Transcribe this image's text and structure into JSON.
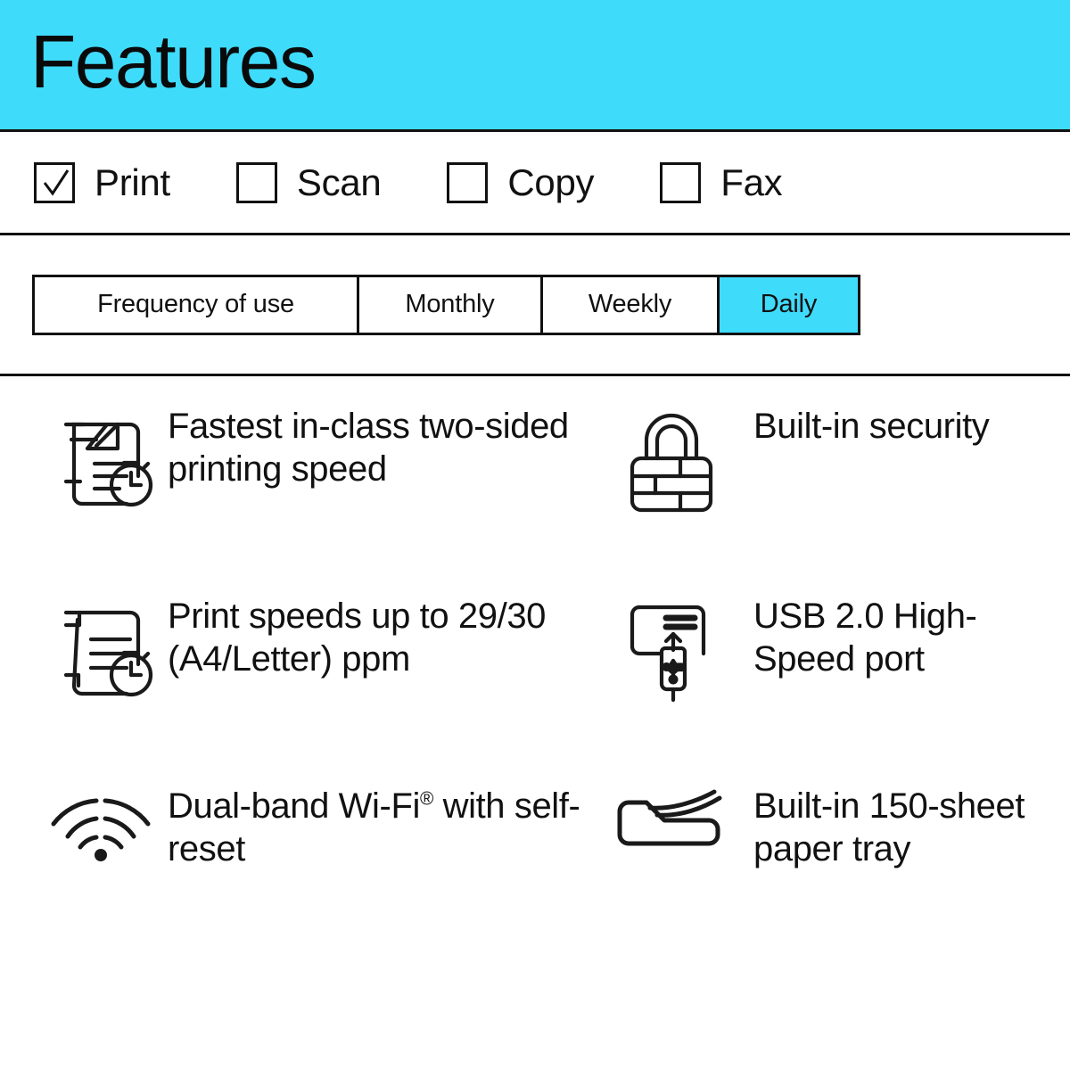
{
  "header": {
    "title": "Features",
    "accent_color": "#3fdbfb"
  },
  "capabilities": {
    "items": [
      {
        "label": "Print",
        "checked": true
      },
      {
        "label": "Scan",
        "checked": false
      },
      {
        "label": "Copy",
        "checked": false
      },
      {
        "label": "Fax",
        "checked": false
      }
    ]
  },
  "frequency": {
    "label": "Frequency of use",
    "options": [
      {
        "label": "Monthly",
        "selected": false
      },
      {
        "label": "Weekly",
        "selected": false
      },
      {
        "label": "Daily",
        "selected": true
      }
    ],
    "selected": "Daily",
    "selected_color": "#3fdbfb"
  },
  "features": {
    "items": [
      {
        "icon": "document-speed-clock-icon",
        "text": "Fastest in-class two-sided printing speed"
      },
      {
        "icon": "padlock-brick-icon",
        "text": "Built-in security"
      },
      {
        "icon": "document-clock-icon",
        "text": "Print speeds up to 29/30 (A4/Letter) ppm"
      },
      {
        "icon": "usb-drive-port-icon",
        "text": "USB 2.0 High-Speed port"
      },
      {
        "icon": "wifi-signal-icon",
        "text_pre": "Dual-band Wi-Fi",
        "text_sup": "®",
        "text_post": " with self-reset"
      },
      {
        "icon": "paper-tray-icon",
        "text": "Built-in 150-sheet paper tray"
      }
    ]
  }
}
